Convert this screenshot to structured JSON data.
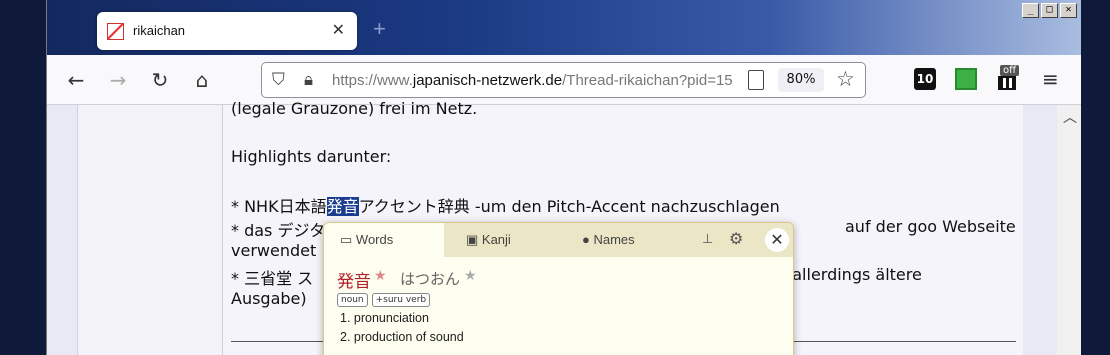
{
  "browser": {
    "tab_title": "rikaichan",
    "tab_close": "✕",
    "new_tab": "+",
    "url_prefix": "https://www.",
    "url_host": "japanisch-netzwerk.de",
    "url_path": "/Thread-rikaichan?pid=15",
    "zoom": "80%",
    "window_controls": [
      "_",
      "□",
      "✕"
    ],
    "extensions": {
      "ext1_label": "10",
      "ext3_badge": "off"
    }
  },
  "page": {
    "lines": [
      "(legale Grauzone) frei im Netz.",
      "Highlights darunter:",
      "verwendet",
      "Ausgabe)"
    ],
    "line3_prefix": "* NHK日本語",
    "line3_selected": "発音",
    "line3_suffix": "アクセント辞典   -um den Pitch-Accent nachzuschlagen",
    "line4_left": "* das デジタ",
    "line4_right": "auf der goo Webseite",
    "line6_left": "* 三省堂   ス",
    "line6_right": "(allerdings ältere"
  },
  "popup": {
    "tabs": [
      "Words",
      "Kanji",
      "Names"
    ],
    "entry": {
      "kanji": "発音",
      "kana": "はつおん",
      "tags": [
        "noun",
        "+suru verb"
      ],
      "definitions": [
        "1. pronunciation",
        "2. production of sound"
      ]
    },
    "close_label": "✕"
  }
}
